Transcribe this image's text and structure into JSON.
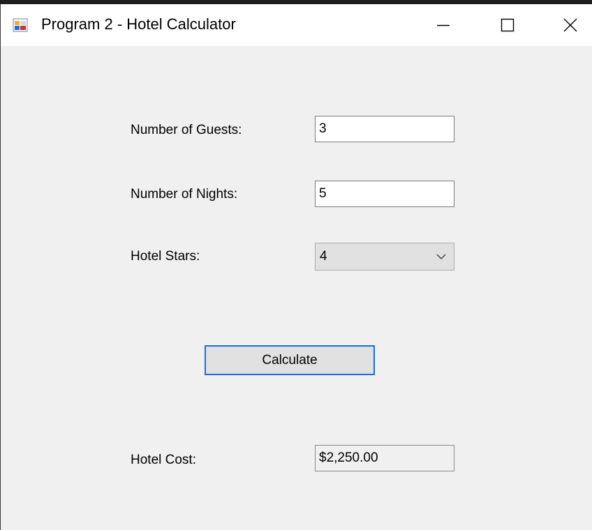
{
  "window": {
    "title": "Program 2 - Hotel Calculator",
    "icon": "winforms-app-icon",
    "caption_buttons": [
      "minimize-icon",
      "maximize-icon",
      "close-icon"
    ]
  },
  "form": {
    "guests": {
      "label": "Number of Guests:",
      "value": "3"
    },
    "nights": {
      "label": "Number of Nights:",
      "value": "5"
    },
    "stars": {
      "label": "Hotel Stars:",
      "selected": "4"
    },
    "calculate_label": "Calculate",
    "cost": {
      "label": "Hotel Cost:",
      "value": "$2,250.00"
    }
  },
  "colors": {
    "form_background": "#f0f0f0",
    "titlebar": "#ffffff",
    "button_focus_border": "#1e6ed6"
  }
}
